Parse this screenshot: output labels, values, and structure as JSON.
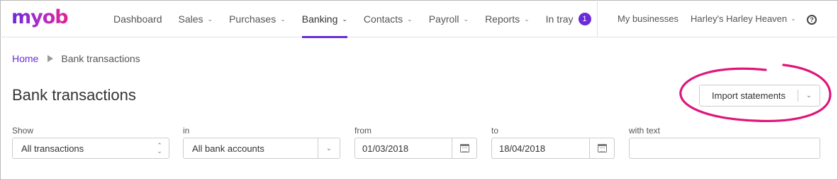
{
  "brand": {
    "logo_text": "myob",
    "accent": "#6b2bd9"
  },
  "nav": {
    "items": [
      {
        "label": "Dashboard",
        "has_menu": false
      },
      {
        "label": "Sales",
        "has_menu": true
      },
      {
        "label": "Purchases",
        "has_menu": true
      },
      {
        "label": "Banking",
        "has_menu": true,
        "active": true
      },
      {
        "label": "Contacts",
        "has_menu": true
      },
      {
        "label": "Payroll",
        "has_menu": true
      },
      {
        "label": "Reports",
        "has_menu": true
      },
      {
        "label": "In tray",
        "has_menu": false,
        "badge": "1"
      }
    ],
    "my_businesses": "My businesses",
    "business_name": "Harley's Harley Heaven",
    "help_icon": "question-circle-icon"
  },
  "breadcrumb": {
    "home": "Home",
    "current": "Bank transactions"
  },
  "page": {
    "title": "Bank transactions"
  },
  "import": {
    "label": "Import statements",
    "highlight_color": "#e0157a"
  },
  "filters": {
    "show": {
      "label": "Show",
      "value": "All transactions"
    },
    "in": {
      "label": "in",
      "value": "All bank accounts"
    },
    "from": {
      "label": "from",
      "value": "01/03/2018"
    },
    "to": {
      "label": "to",
      "value": "18/04/2018"
    },
    "with_text": {
      "label": "with text",
      "value": ""
    }
  }
}
